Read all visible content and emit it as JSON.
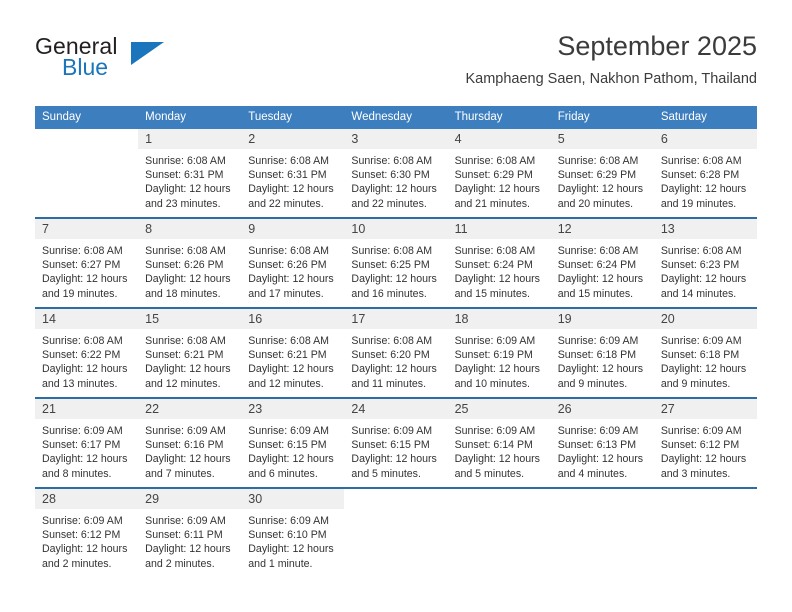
{
  "brand": {
    "name_top": "General",
    "name_bottom": "Blue",
    "color_dark": "#231f20",
    "color_blue": "#1b75bc"
  },
  "header": {
    "title": "September 2025",
    "subtitle": "Kamphaeng Saen, Nakhon Pathom, Thailand"
  },
  "theme": {
    "header_row_bg": "#3d7ebf",
    "week_separator": "#2e6da4",
    "daynum_band_bg": "#f0f0f0",
    "text": "#333333"
  },
  "weekdays": [
    "Sunday",
    "Monday",
    "Tuesday",
    "Wednesday",
    "Thursday",
    "Friday",
    "Saturday"
  ],
  "weeks": [
    [
      {
        "day": "",
        "sunrise": "",
        "sunset": "",
        "daylight_1": "",
        "daylight_2": ""
      },
      {
        "day": "1",
        "sunrise": "Sunrise: 6:08 AM",
        "sunset": "Sunset: 6:31 PM",
        "daylight_1": "Daylight: 12 hours",
        "daylight_2": "and 23 minutes."
      },
      {
        "day": "2",
        "sunrise": "Sunrise: 6:08 AM",
        "sunset": "Sunset: 6:31 PM",
        "daylight_1": "Daylight: 12 hours",
        "daylight_2": "and 22 minutes."
      },
      {
        "day": "3",
        "sunrise": "Sunrise: 6:08 AM",
        "sunset": "Sunset: 6:30 PM",
        "daylight_1": "Daylight: 12 hours",
        "daylight_2": "and 22 minutes."
      },
      {
        "day": "4",
        "sunrise": "Sunrise: 6:08 AM",
        "sunset": "Sunset: 6:29 PM",
        "daylight_1": "Daylight: 12 hours",
        "daylight_2": "and 21 minutes."
      },
      {
        "day": "5",
        "sunrise": "Sunrise: 6:08 AM",
        "sunset": "Sunset: 6:29 PM",
        "daylight_1": "Daylight: 12 hours",
        "daylight_2": "and 20 minutes."
      },
      {
        "day": "6",
        "sunrise": "Sunrise: 6:08 AM",
        "sunset": "Sunset: 6:28 PM",
        "daylight_1": "Daylight: 12 hours",
        "daylight_2": "and 19 minutes."
      }
    ],
    [
      {
        "day": "7",
        "sunrise": "Sunrise: 6:08 AM",
        "sunset": "Sunset: 6:27 PM",
        "daylight_1": "Daylight: 12 hours",
        "daylight_2": "and 19 minutes."
      },
      {
        "day": "8",
        "sunrise": "Sunrise: 6:08 AM",
        "sunset": "Sunset: 6:26 PM",
        "daylight_1": "Daylight: 12 hours",
        "daylight_2": "and 18 minutes."
      },
      {
        "day": "9",
        "sunrise": "Sunrise: 6:08 AM",
        "sunset": "Sunset: 6:26 PM",
        "daylight_1": "Daylight: 12 hours",
        "daylight_2": "and 17 minutes."
      },
      {
        "day": "10",
        "sunrise": "Sunrise: 6:08 AM",
        "sunset": "Sunset: 6:25 PM",
        "daylight_1": "Daylight: 12 hours",
        "daylight_2": "and 16 minutes."
      },
      {
        "day": "11",
        "sunrise": "Sunrise: 6:08 AM",
        "sunset": "Sunset: 6:24 PM",
        "daylight_1": "Daylight: 12 hours",
        "daylight_2": "and 15 minutes."
      },
      {
        "day": "12",
        "sunrise": "Sunrise: 6:08 AM",
        "sunset": "Sunset: 6:24 PM",
        "daylight_1": "Daylight: 12 hours",
        "daylight_2": "and 15 minutes."
      },
      {
        "day": "13",
        "sunrise": "Sunrise: 6:08 AM",
        "sunset": "Sunset: 6:23 PM",
        "daylight_1": "Daylight: 12 hours",
        "daylight_2": "and 14 minutes."
      }
    ],
    [
      {
        "day": "14",
        "sunrise": "Sunrise: 6:08 AM",
        "sunset": "Sunset: 6:22 PM",
        "daylight_1": "Daylight: 12 hours",
        "daylight_2": "and 13 minutes."
      },
      {
        "day": "15",
        "sunrise": "Sunrise: 6:08 AM",
        "sunset": "Sunset: 6:21 PM",
        "daylight_1": "Daylight: 12 hours",
        "daylight_2": "and 12 minutes."
      },
      {
        "day": "16",
        "sunrise": "Sunrise: 6:08 AM",
        "sunset": "Sunset: 6:21 PM",
        "daylight_1": "Daylight: 12 hours",
        "daylight_2": "and 12 minutes."
      },
      {
        "day": "17",
        "sunrise": "Sunrise: 6:08 AM",
        "sunset": "Sunset: 6:20 PM",
        "daylight_1": "Daylight: 12 hours",
        "daylight_2": "and 11 minutes."
      },
      {
        "day": "18",
        "sunrise": "Sunrise: 6:09 AM",
        "sunset": "Sunset: 6:19 PM",
        "daylight_1": "Daylight: 12 hours",
        "daylight_2": "and 10 minutes."
      },
      {
        "day": "19",
        "sunrise": "Sunrise: 6:09 AM",
        "sunset": "Sunset: 6:18 PM",
        "daylight_1": "Daylight: 12 hours",
        "daylight_2": "and 9 minutes."
      },
      {
        "day": "20",
        "sunrise": "Sunrise: 6:09 AM",
        "sunset": "Sunset: 6:18 PM",
        "daylight_1": "Daylight: 12 hours",
        "daylight_2": "and 9 minutes."
      }
    ],
    [
      {
        "day": "21",
        "sunrise": "Sunrise: 6:09 AM",
        "sunset": "Sunset: 6:17 PM",
        "daylight_1": "Daylight: 12 hours",
        "daylight_2": "and 8 minutes."
      },
      {
        "day": "22",
        "sunrise": "Sunrise: 6:09 AM",
        "sunset": "Sunset: 6:16 PM",
        "daylight_1": "Daylight: 12 hours",
        "daylight_2": "and 7 minutes."
      },
      {
        "day": "23",
        "sunrise": "Sunrise: 6:09 AM",
        "sunset": "Sunset: 6:15 PM",
        "daylight_1": "Daylight: 12 hours",
        "daylight_2": "and 6 minutes."
      },
      {
        "day": "24",
        "sunrise": "Sunrise: 6:09 AM",
        "sunset": "Sunset: 6:15 PM",
        "daylight_1": "Daylight: 12 hours",
        "daylight_2": "and 5 minutes."
      },
      {
        "day": "25",
        "sunrise": "Sunrise: 6:09 AM",
        "sunset": "Sunset: 6:14 PM",
        "daylight_1": "Daylight: 12 hours",
        "daylight_2": "and 5 minutes."
      },
      {
        "day": "26",
        "sunrise": "Sunrise: 6:09 AM",
        "sunset": "Sunset: 6:13 PM",
        "daylight_1": "Daylight: 12 hours",
        "daylight_2": "and 4 minutes."
      },
      {
        "day": "27",
        "sunrise": "Sunrise: 6:09 AM",
        "sunset": "Sunset: 6:12 PM",
        "daylight_1": "Daylight: 12 hours",
        "daylight_2": "and 3 minutes."
      }
    ],
    [
      {
        "day": "28",
        "sunrise": "Sunrise: 6:09 AM",
        "sunset": "Sunset: 6:12 PM",
        "daylight_1": "Daylight: 12 hours",
        "daylight_2": "and 2 minutes."
      },
      {
        "day": "29",
        "sunrise": "Sunrise: 6:09 AM",
        "sunset": "Sunset: 6:11 PM",
        "daylight_1": "Daylight: 12 hours",
        "daylight_2": "and 2 minutes."
      },
      {
        "day": "30",
        "sunrise": "Sunrise: 6:09 AM",
        "sunset": "Sunset: 6:10 PM",
        "daylight_1": "Daylight: 12 hours",
        "daylight_2": "and 1 minute."
      },
      {
        "day": "",
        "sunrise": "",
        "sunset": "",
        "daylight_1": "",
        "daylight_2": ""
      },
      {
        "day": "",
        "sunrise": "",
        "sunset": "",
        "daylight_1": "",
        "daylight_2": ""
      },
      {
        "day": "",
        "sunrise": "",
        "sunset": "",
        "daylight_1": "",
        "daylight_2": ""
      },
      {
        "day": "",
        "sunrise": "",
        "sunset": "",
        "daylight_1": "",
        "daylight_2": ""
      }
    ]
  ]
}
